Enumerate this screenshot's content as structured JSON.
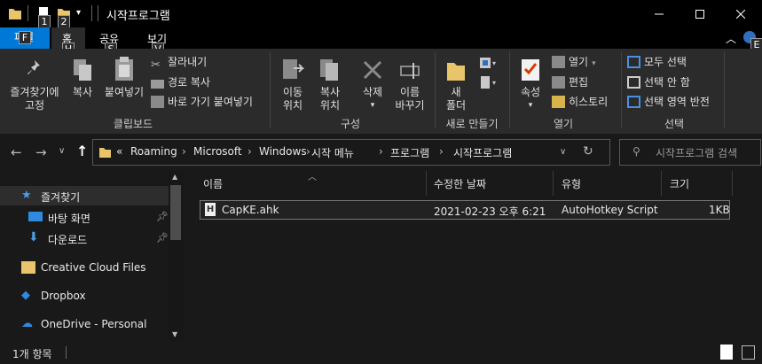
{
  "window": {
    "title": "시작프로그램",
    "qa_key1": "1",
    "qa_key2": "2"
  },
  "ribbon_tabs": [
    {
      "label": "파일",
      "key": "F"
    },
    {
      "label": "홈",
      "key": "H"
    },
    {
      "label": "공유",
      "key": "S"
    },
    {
      "label": "보기",
      "key": "V"
    }
  ],
  "ribbon_help_key": "E",
  "clipboard": {
    "pin_line1": "즐겨찾기에",
    "pin_line2": "고정",
    "copy": "복사",
    "paste": "붙여넣기",
    "cut": "잘라내기",
    "copy_path": "경로 복사",
    "paste_shortcut": "바로 가기 붙여넣기",
    "group": "클립보드"
  },
  "organize": {
    "move_line1": "이동",
    "move_line2": "위치",
    "copyto_line1": "복사",
    "copyto_line2": "위치",
    "delete": "삭제",
    "rename_line1": "이름",
    "rename_line2": "바꾸기",
    "group": "구성"
  },
  "new": {
    "folder_line1": "새",
    "folder_line2": "폴더",
    "group": "새로 만들기"
  },
  "open": {
    "properties": "속성",
    "open": "열기",
    "edit": "편집",
    "history": "히스토리",
    "group": "열기"
  },
  "select": {
    "all": "모두 선택",
    "none": "선택 안 함",
    "invert": "선택 영역 반전",
    "group": "선택"
  },
  "address": {
    "overflow": "«",
    "crumbs": [
      "Roaming",
      "Microsoft",
      "Windows",
      "시작 메뉴",
      "프로그램",
      "시작프로그램"
    ],
    "search_placeholder": "시작프로그램 검색"
  },
  "nav": {
    "items": [
      {
        "label": "즐겨찾기",
        "icon": "star-icon"
      },
      {
        "label": "바탕 화면",
        "icon": "desktop-icon"
      },
      {
        "label": "다운로드",
        "icon": "download-icon"
      },
      {
        "label": "Creative Cloud Files",
        "icon": "creative-cloud-icon"
      },
      {
        "label": "Dropbox",
        "icon": "dropbox-icon"
      },
      {
        "label": "OneDrive - Personal",
        "icon": "onedrive-icon"
      }
    ]
  },
  "list": {
    "columns": [
      "이름",
      "수정한 날짜",
      "유형",
      "크기"
    ],
    "rows": [
      {
        "name": "CapKE.ahk",
        "modified": "2021-02-23 오후 6:21",
        "type": "AutoHotkey Script",
        "size": "1KB"
      }
    ]
  },
  "status": {
    "count": "1개 항목"
  },
  "colors": {
    "accent": "#0078d7",
    "folder": "#e8c46a"
  }
}
